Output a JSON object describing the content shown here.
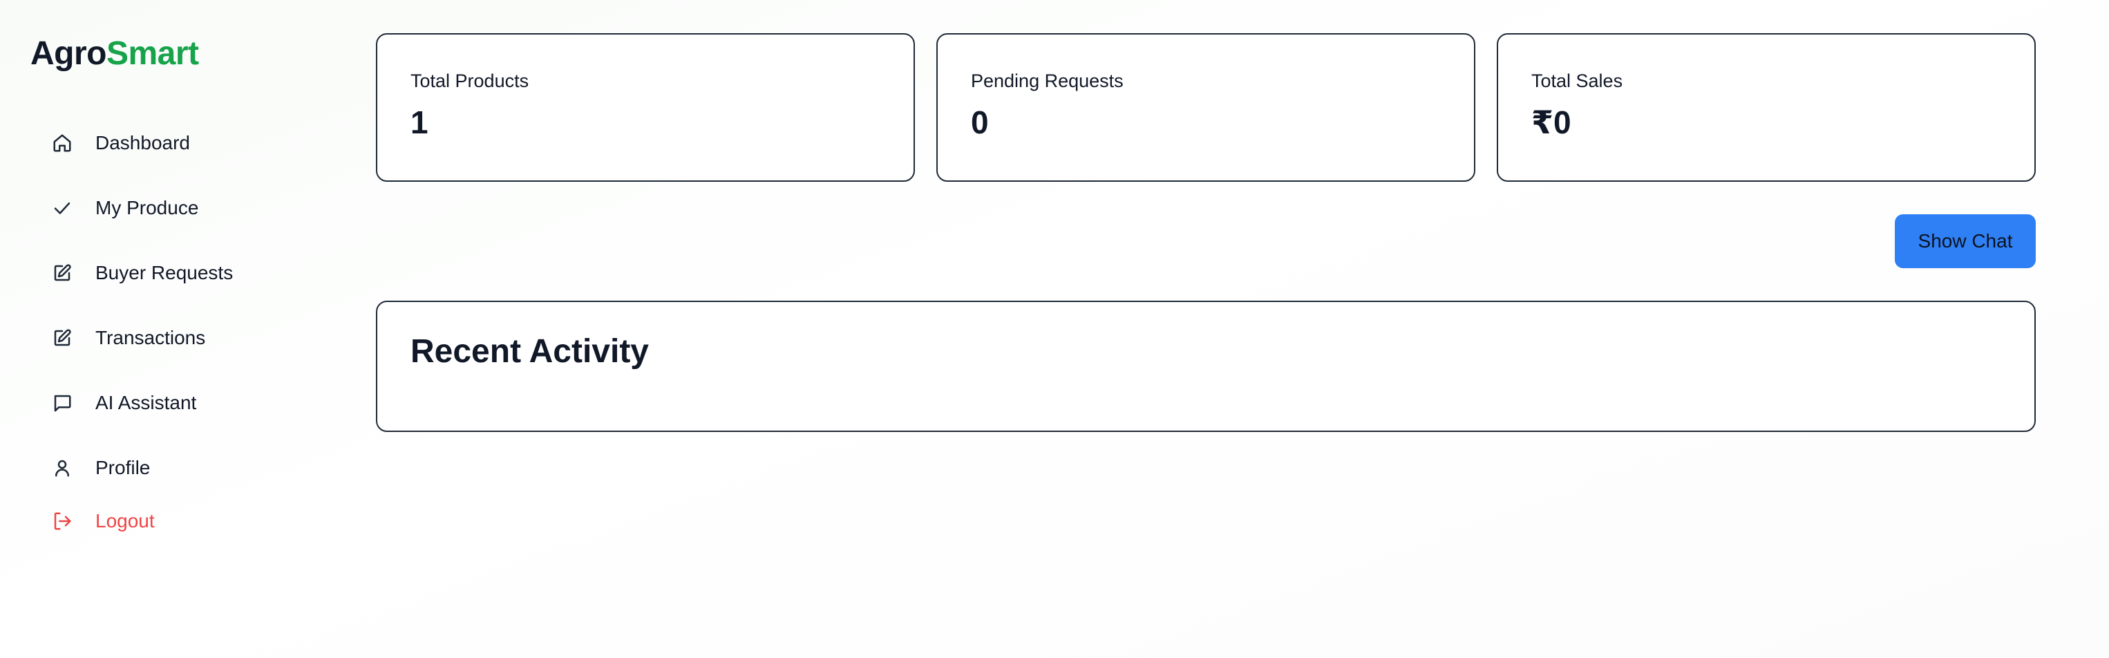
{
  "app": {
    "logo_part1": "Agro",
    "logo_part2": "Smart",
    "brand_color": "#16a34a"
  },
  "sidebar": {
    "items": [
      {
        "label": "Dashboard",
        "icon": "home-icon"
      },
      {
        "label": "My Produce",
        "icon": "check-icon"
      },
      {
        "label": "Buyer Requests",
        "icon": "edit-icon"
      },
      {
        "label": "Transactions",
        "icon": "edit-icon"
      },
      {
        "label": "AI Assistant",
        "icon": "message-icon"
      },
      {
        "label": "Profile",
        "icon": "user-icon"
      }
    ],
    "logout": {
      "label": "Logout",
      "icon": "logout-icon",
      "color": "#ef4444"
    }
  },
  "stats": [
    {
      "label": "Total Products",
      "value": "1"
    },
    {
      "label": "Pending Requests",
      "value": "0"
    },
    {
      "label": "Total Sales",
      "value": "₹0"
    }
  ],
  "chat_button": {
    "label": "Show Chat",
    "color": "#2f80f5"
  },
  "activity": {
    "title": "Recent Activity"
  }
}
